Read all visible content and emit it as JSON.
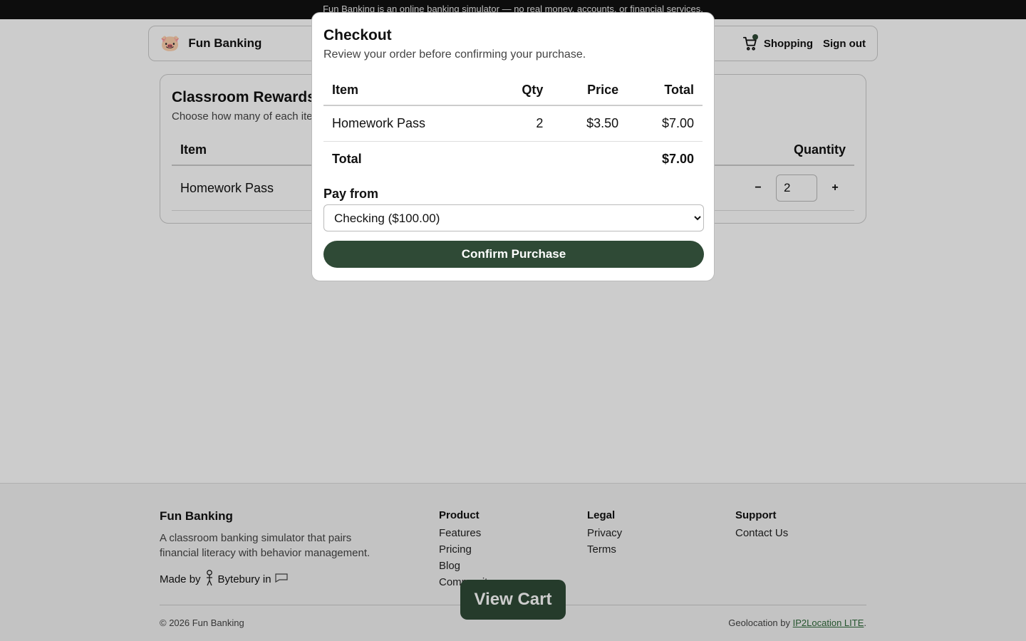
{
  "banner": {
    "text": "Fun Banking is an online banking simulator — no real money, accounts, or financial services."
  },
  "navbar": {
    "logo_icon": "pig-icon",
    "brand": "Fun Banking",
    "cart_icon": "shopping-cart-icon",
    "shopping_label": "Shopping",
    "signout_label": "Sign out"
  },
  "store": {
    "title": "Classroom Rewards",
    "subtitle": "Choose how many of each item",
    "columns": {
      "item": "Item",
      "quantity": "Quantity"
    },
    "rows": [
      {
        "item": "Homework Pass",
        "quantity": "2"
      }
    ],
    "decrement_label": "−",
    "increment_label": "+"
  },
  "checkout": {
    "title": "Checkout",
    "subtitle": "Review your order before confirming your purchase.",
    "columns": {
      "item": "Item",
      "qty": "Qty",
      "price": "Price",
      "total": "Total"
    },
    "rows": [
      {
        "item": "Homework Pass",
        "qty": "2",
        "price": "$3.50",
        "total": "$7.00"
      }
    ],
    "total_label": "Total",
    "total_value": "$7.00",
    "pay_from_label": "Pay from",
    "pay_from_selected": "Checking ($100.00)",
    "confirm_label": "Confirm Purchase"
  },
  "view_cart_label": "View Cart",
  "footer": {
    "brand": "Fun Banking",
    "description": "A classroom banking simulator that pairs financial literacy with behavior management.",
    "made_by_prefix": "Made by",
    "made_by_name": "Bytebury in",
    "columns": [
      {
        "heading": "Product",
        "links": [
          "Features",
          "Pricing",
          "Blog",
          "Community"
        ]
      },
      {
        "heading": "Legal",
        "links": [
          "Privacy",
          "Terms"
        ]
      },
      {
        "heading": "Support",
        "links": [
          "Contact Us"
        ]
      }
    ],
    "copyright": "© 2026 Fun Banking",
    "geo_prefix": "Geolocation by",
    "geo_link": "IP2Location LITE",
    "geo_suffix": "."
  },
  "colors": {
    "accent": "#2f4a36",
    "banner_bg": "#111111",
    "overlay": "rgba(0,0,0,0.2)"
  }
}
